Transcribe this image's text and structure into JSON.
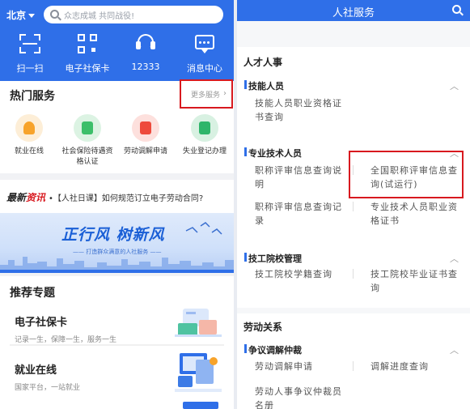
{
  "left": {
    "header": {
      "city": "北京",
      "search_placeholder": "众志成城  共同战役!",
      "quick_actions": [
        {
          "label": "扫一扫",
          "icon": "scan-icon"
        },
        {
          "label": "电子社保卡",
          "icon": "qr-code-icon"
        },
        {
          "label": "12333",
          "icon": "headset-icon"
        },
        {
          "label": "消息中心",
          "icon": "message-icon"
        }
      ]
    },
    "hot": {
      "title": "热门服务",
      "more_label": "更多服务",
      "services": [
        {
          "label": "就业在线",
          "icon": "employment-icon",
          "color": "#f7a32b"
        },
        {
          "label": "社会保险待遇资格认证",
          "icon": "insurance-icon",
          "color": "#3cbf6a"
        },
        {
          "label": "劳动调解申请",
          "icon": "mediation-icon",
          "color": "#ee4a3c"
        },
        {
          "label": "失业登记办理",
          "icon": "unemployment-icon",
          "color": "#2eb56a"
        }
      ]
    },
    "news": {
      "tag_a": "最新",
      "tag_b": "资讯",
      "text": "•【人社日课】如何规范订立电子劳动合同?"
    },
    "banner": {
      "headline": "正行风  树新风",
      "tagline": "—— 打造群众满意的人社服务 ——"
    },
    "recommend": {
      "title": "推荐专题",
      "items": [
        {
          "title": "电子社保卡",
          "subtitle": "记录一生，保障一生，服务一生"
        },
        {
          "title": "就业在线",
          "subtitle": "国家平台，一站就业"
        }
      ]
    }
  },
  "right": {
    "header": {
      "title": "人社服务"
    },
    "sections": [
      {
        "title": "人才人事",
        "groups": [
          {
            "title": "技能人员",
            "items": [
              "技能人员职业资格证书查询"
            ]
          },
          {
            "title": "专业技术人员",
            "items": [
              "职称评审信息查询说明",
              "全国职称评审信息查询(试运行)",
              "职称评审信息查询记录",
              "专业技术人员职业资格证书"
            ]
          },
          {
            "title": "技工院校管理",
            "items": [
              "技工院校学籍查询",
              "技工院校毕业证书查询"
            ]
          }
        ]
      },
      {
        "title": "劳动关系",
        "groups": [
          {
            "title": "争议调解仲裁",
            "items": [
              "劳动调解申请",
              "调解进度查询",
              "劳动人事争议仲裁员名册"
            ]
          }
        ]
      }
    ]
  }
}
